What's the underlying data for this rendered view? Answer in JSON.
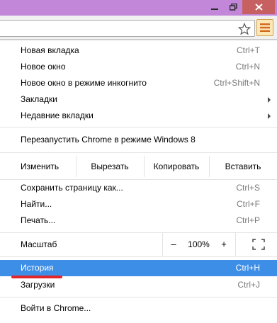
{
  "window": {
    "controls": [
      "minimize",
      "maximize",
      "close"
    ]
  },
  "toolbar": {
    "star_icon": "star-icon",
    "menu_icon": "hamburger-menu-icon",
    "accent_color": "#fde7b7"
  },
  "menu": {
    "items_group1": [
      {
        "label": "Новая вкладка",
        "shortcut": "Ctrl+T"
      },
      {
        "label": "Новое окно",
        "shortcut": "Ctrl+N"
      },
      {
        "label": "Новое окно в режиме инкогнито",
        "shortcut": "Ctrl+Shift+N"
      },
      {
        "label": "Закладки",
        "shortcut": ""
      },
      {
        "label": "Недавние вкладки",
        "shortcut": ""
      }
    ],
    "relaunch": {
      "label": "Перезапустить Chrome в режиме Windows 8"
    },
    "edit": {
      "label": "Изменить",
      "cut": "Вырезать",
      "copy": "Копировать",
      "paste": "Вставить"
    },
    "items_group2": [
      {
        "label": "Сохранить страницу как...",
        "shortcut": "Ctrl+S"
      },
      {
        "label": "Найти...",
        "shortcut": "Ctrl+F"
      },
      {
        "label": "Печать...",
        "shortcut": "Ctrl+P"
      }
    ],
    "zoom": {
      "label": "Масштаб",
      "minus": "–",
      "value": "100%",
      "plus": "+"
    },
    "items_group3": [
      {
        "label": "История",
        "shortcut": "Ctrl+H"
      },
      {
        "label": "Загрузки",
        "shortcut": "Ctrl+J"
      }
    ],
    "signin": {
      "label": "Войти в Chrome..."
    },
    "highlight_color": "#3d8ee6",
    "annotation_color": "#e0262b"
  }
}
